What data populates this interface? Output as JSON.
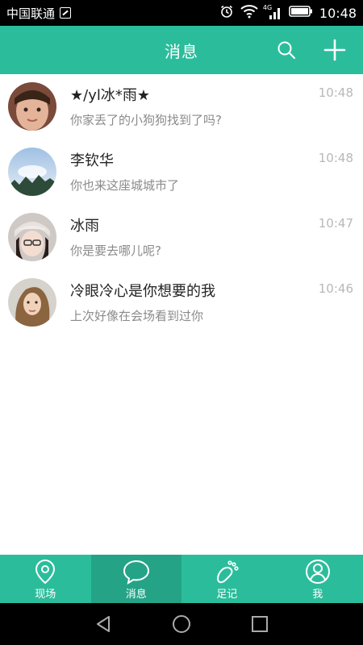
{
  "status_bar": {
    "carrier": "中国联通",
    "network": "4G",
    "time": "10:48"
  },
  "header": {
    "title": "消息",
    "background": "#2bbd9b"
  },
  "conversations": [
    {
      "name": "★/yl冰*雨★",
      "preview": "你家丢了的小狗狗找到了吗?",
      "time": "10:48",
      "avatar_colors": [
        "#e3b49a",
        "#7a4a3a"
      ]
    },
    {
      "name": "李钦华",
      "preview": "你也来这座城城市了",
      "time": "10:48",
      "avatar_colors": [
        "#c9dbef",
        "#4a6e93"
      ]
    },
    {
      "name": "冰雨",
      "preview": "你是要去哪儿呢?",
      "time": "10:47",
      "avatar_colors": [
        "#efe6e1",
        "#3a2a2a"
      ]
    },
    {
      "name": "冷眼冷心是你想要的我",
      "preview": "上次好像在会场看到过你",
      "time": "10:46",
      "avatar_colors": [
        "#d9c2a6",
        "#5a3d2a"
      ]
    }
  ],
  "tabs": [
    {
      "label": "现场",
      "icon": "location-pin-icon",
      "active": false
    },
    {
      "label": "消息",
      "icon": "chat-bubble-icon",
      "active": true
    },
    {
      "label": "足记",
      "icon": "footprint-icon",
      "active": false
    },
    {
      "label": "我",
      "icon": "user-icon",
      "active": false
    }
  ],
  "colors": {
    "accent": "#2bbd9b",
    "accent_active": "#25a386",
    "time_text": "#b8b8b8",
    "preview_text": "#8a8a8a"
  }
}
